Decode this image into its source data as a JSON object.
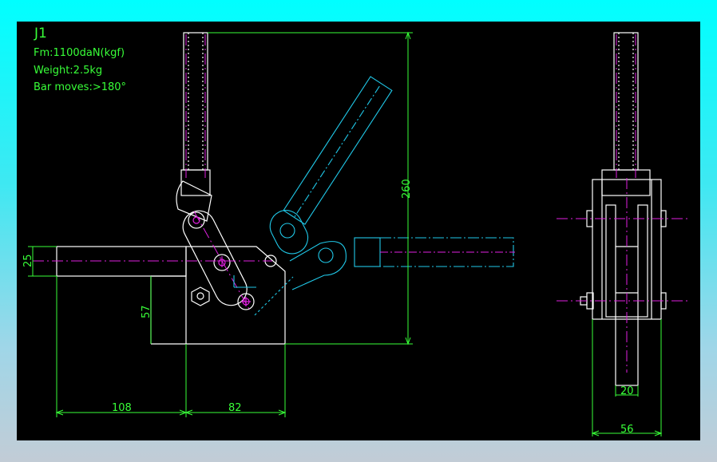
{
  "drawing": {
    "title": "J1",
    "spec_force": "Fm:1100daN(kgf)",
    "spec_weight": "Weight:2.5kg",
    "spec_bar": "Bar moves:>180°",
    "dim_height": "260",
    "dim_bar": "25",
    "dim_base": "57",
    "dim_left": "108",
    "dim_right": "82",
    "dim_inner_width": "20",
    "dim_outer_width": "56"
  },
  "colors": {
    "background": "#000000",
    "outline": "#ffffff",
    "dimension": "#38ff38",
    "centerline": "#e020e0",
    "alternate_position": "#20c8e8"
  }
}
